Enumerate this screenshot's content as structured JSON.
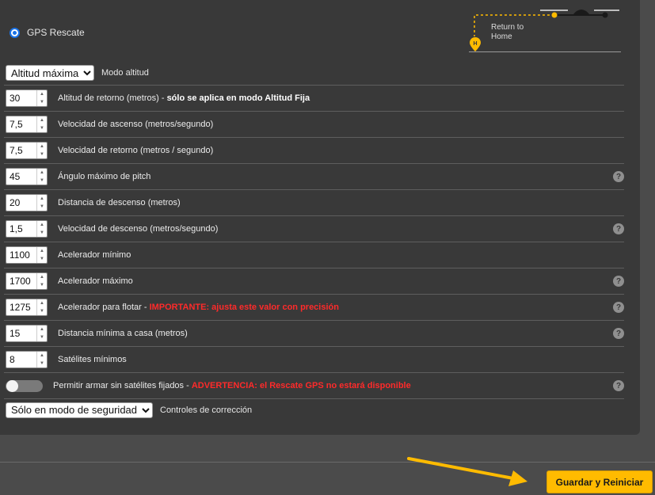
{
  "gps_rescue": {
    "label": "GPS Rescate",
    "selected": true
  },
  "rth_diagram": {
    "label_line1": "Return to",
    "label_line2": "Home",
    "home_marker": "H",
    "accent": "#ffbb00"
  },
  "altitude_mode": {
    "selected": "Altitud máxima",
    "label": "Modo altitud"
  },
  "params": [
    {
      "value": "30",
      "label": "Altitud de retorno (metros) - ",
      "bold": "sólo se aplica en modo Altitud Fija",
      "warning": "",
      "help": false
    },
    {
      "value": "7,5",
      "label": "Velocidad de ascenso (metros/segundo)",
      "bold": "",
      "warning": "",
      "help": false
    },
    {
      "value": "7,5",
      "label": "Velocidad de retorno (metros / segundo)",
      "bold": "",
      "warning": "",
      "help": false
    },
    {
      "value": "45",
      "label": "Ángulo máximo de pitch",
      "bold": "",
      "warning": "",
      "help": true
    },
    {
      "value": "20",
      "label": "Distancia de descenso (metros)",
      "bold": "",
      "warning": "",
      "help": false
    },
    {
      "value": "1,5",
      "label": "Velocidad de descenso (metros/segundo)",
      "bold": "",
      "warning": "",
      "help": true
    },
    {
      "value": "1100",
      "label": "Acelerador mínimo",
      "bold": "",
      "warning": "",
      "help": false
    },
    {
      "value": "1700",
      "label": "Acelerador máximo",
      "bold": "",
      "warning": "",
      "help": true
    },
    {
      "value": "1275",
      "label": "Acelerador para flotar - ",
      "bold": "",
      "warning": "IMPORTANTE: ajusta este valor con precisión",
      "help": true
    },
    {
      "value": "15",
      "label": "Distancia mínima a casa (metros)",
      "bold": "",
      "warning": "",
      "help": true
    },
    {
      "value": "8",
      "label": "Satélites mínimos",
      "bold": "",
      "warning": "",
      "help": false
    }
  ],
  "arm_toggle": {
    "label": "Permitir armar sin satélites fijados - ",
    "warning": "ADVERTENCIA: el Rescate GPS no estará disponible",
    "on": false
  },
  "help_glyph": "?",
  "spinner_up": "▲",
  "spinner_down": "▼",
  "sanity_mode": {
    "selected": "Sólo en modo de seguridad",
    "label": "Controles de corrección"
  },
  "save_button": {
    "label": "Guardar y Reiniciar"
  },
  "colors": {
    "warning": "#ff2a2a",
    "save": "#ffbb00",
    "radio": "#1a73e8"
  }
}
